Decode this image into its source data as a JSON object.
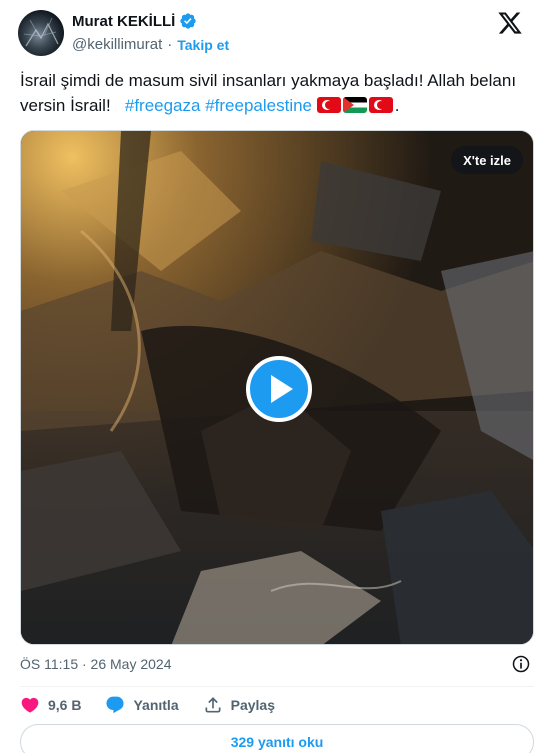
{
  "author": {
    "display_name": "Murat KEKİLLİ",
    "handle": "@kekillimurat",
    "separator": "·",
    "follow_label": "Takip et",
    "verified_color": "#1d9bf0"
  },
  "tweet": {
    "text_main": "İsrail şimdi de masum sivil insanları yakmaya başladı! Allah belanı versin İsrail!",
    "hashtags": [
      "#freegaza",
      "#freepalestine"
    ],
    "flags": [
      "flag-turkey",
      "flag-palestine",
      "flag-turkey"
    ],
    "trailing": "."
  },
  "media": {
    "watch_label": "X'te izle",
    "play_icon": "play-icon"
  },
  "timestamp": "ÖS 11:15 · 26 May 2024",
  "actions": {
    "like_count": "9,6 B",
    "reply_label": "Yanıtla",
    "share_label": "Paylaş"
  },
  "replies_button": "329 yanıtı oku",
  "colors": {
    "accent": "#1d9bf0",
    "like": "#f91880",
    "muted": "#536471"
  }
}
